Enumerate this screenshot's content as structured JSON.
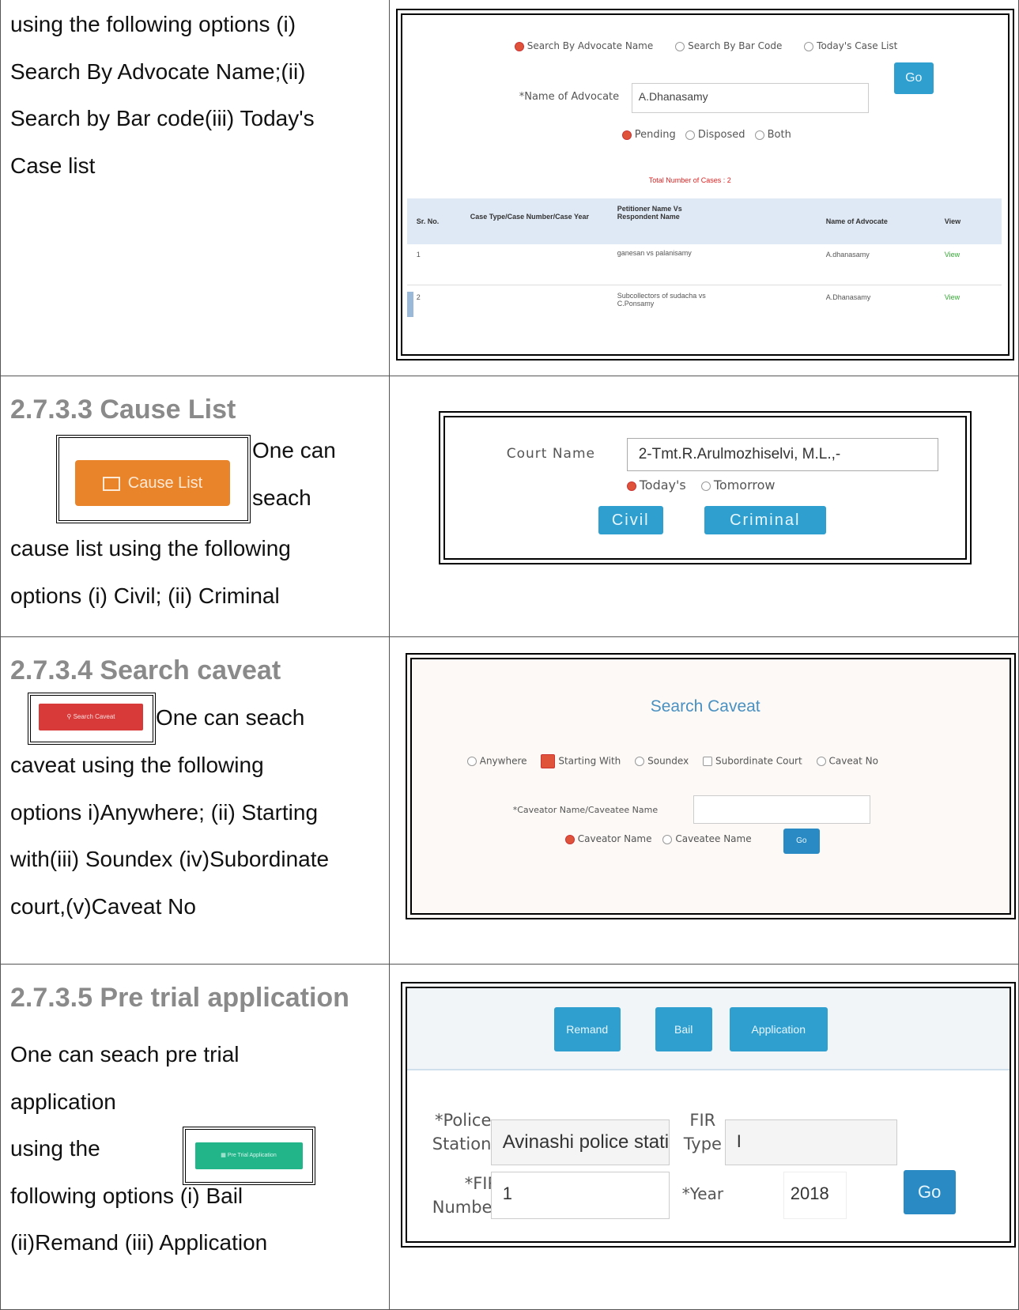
{
  "rows": [
    {
      "left_lines": [
        "using the following options (i)",
        "Search By Advocate Name;(ii)",
        "Search by Bar code(iii) Today's",
        "Case list"
      ],
      "shot": {
        "radios": [
          "Search By Advocate Name",
          "Search By Bar Code",
          "Today's Case List"
        ],
        "go": "Go",
        "advocate_label": "*Name of Advocate",
        "advocate_value": "A.Dhanasamy",
        "status_radios": [
          "Pending",
          "Disposed",
          "Both"
        ],
        "total": "Total Number of Cases : 2",
        "headers": [
          "Sr. No.",
          "Case Type/Case Number/Case Year",
          "Petitioner Name Vs Respondent Name",
          "Name of Advocate",
          "View"
        ],
        "table_rows": [
          {
            "sr": "1",
            "case": "",
            "parties": "ganesan vs palanisamy",
            "advocate": "A.dhanasamy",
            "view": "View"
          },
          {
            "sr": "2",
            "case": "",
            "parties": "Subcollectors of sudacha vs C.Ponsamy",
            "advocate": "A.Dhanasamy",
            "view": "View"
          }
        ]
      }
    },
    {
      "heading": "2.7.3.3 Cause List",
      "icon_label": "Cause List",
      "text_inline": [
        "One can",
        "seach"
      ],
      "left_lines": [
        "cause list using the following",
        "options (i) Civil; (ii) Criminal"
      ],
      "shot": {
        "court_label": "Court Name",
        "court_value": "2-Tmt.R.Arulmozhiselvi, M.L.,-",
        "radios": [
          "Today's",
          "Tomorrow"
        ],
        "buttons": [
          "Civil",
          "Criminal"
        ]
      }
    },
    {
      "heading": "2.7.3.4 Search caveat",
      "icon_label": "Search Caveat",
      "text_inline": "One can seach",
      "left_lines": [
        "caveat  using the following",
        "options i)Anywhere; (ii) Starting",
        "with(iii) Soundex (iv)Subordinate",
        "court,(v)Caveat No"
      ],
      "shot": {
        "title": "Search Caveat",
        "options": [
          "Anywhere",
          "Starting With",
          "Soundex",
          "Subordinate Court",
          "Caveat No"
        ],
        "name_label": "*Caveator Name/Caveatee Name",
        "name_radios": [
          "Caveator Name",
          "Caveatee Name"
        ],
        "go": "Go"
      }
    },
    {
      "heading": "2.7.3.5 Pre trial application",
      "left_lines_a": [
        "One can seach pre trial",
        "application"
      ],
      "icon_label": "Pre Trial Application",
      "left_lines_b": [
        "using the",
        "following options (i) Bail",
        "(ii)Remand (iii) Application"
      ],
      "shot": {
        "tabs": [
          "Remand",
          "Bail",
          "Application"
        ],
        "police_label": [
          "*Police",
          "Station"
        ],
        "police_value": "Avinashi police static",
        "fir_type_label": [
          "FIR",
          "Type"
        ],
        "fir_type_value": "I",
        "fir_number_label": [
          "*FIR",
          "Number"
        ],
        "fir_number_value": "1",
        "year_label": "*Year",
        "year_value": "2018",
        "go": "Go"
      }
    }
  ]
}
